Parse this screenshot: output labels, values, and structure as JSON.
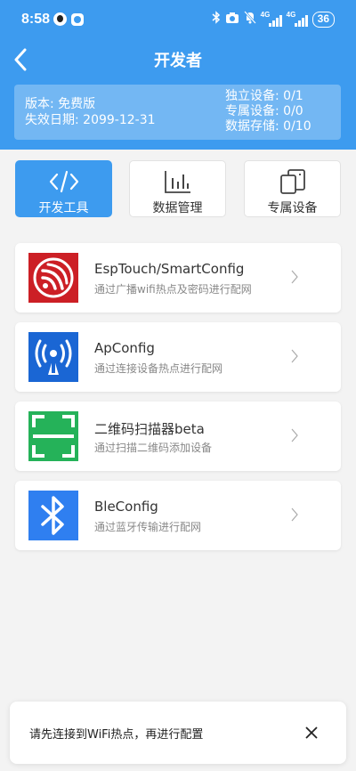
{
  "status_bar": {
    "time": "8:58",
    "network_1": "4G",
    "network_2": "4G",
    "battery": "36"
  },
  "nav": {
    "title": "开发者",
    "back_icon": "chevron-left-icon"
  },
  "info": {
    "version": "版本: 免费版",
    "expiry": "失效日期: 2099-12-31",
    "standalone": "独立设备: 0/1",
    "dedicated": "专属设备: 0/0",
    "storage": "数据存储: 0/10"
  },
  "tabs": [
    {
      "label": "开发工具",
      "icon": "code-icon",
      "active": true
    },
    {
      "label": "数据管理",
      "icon": "bar-chart-icon",
      "active": false
    },
    {
      "label": "专属设备",
      "icon": "devices-icon",
      "active": false
    }
  ],
  "tools": [
    {
      "title": "EspTouch/SmartConfig",
      "subtitle": "通过广播wifi热点及密码进行配网",
      "icon": "espressif-logo-icon",
      "color": "#cc1f25"
    },
    {
      "title": "ApConfig",
      "subtitle": "通过连接设备热点进行配网",
      "icon": "antenna-icon",
      "color": "#1a66d4"
    },
    {
      "title": "二维码扫描器beta",
      "subtitle": "通过扫描二维码添加设备",
      "icon": "qr-scan-icon",
      "color": "#25b259"
    },
    {
      "title": "BleConfig",
      "subtitle": "通过蓝牙传输进行配网",
      "icon": "bluetooth-icon",
      "color": "#2f7ff0"
    }
  ],
  "toast": {
    "text": "请先连接到WiFi热点，再进行配置",
    "close_icon": "close-icon"
  },
  "colors": {
    "primary": "#3d9bef",
    "background": "#f3f3f3"
  }
}
